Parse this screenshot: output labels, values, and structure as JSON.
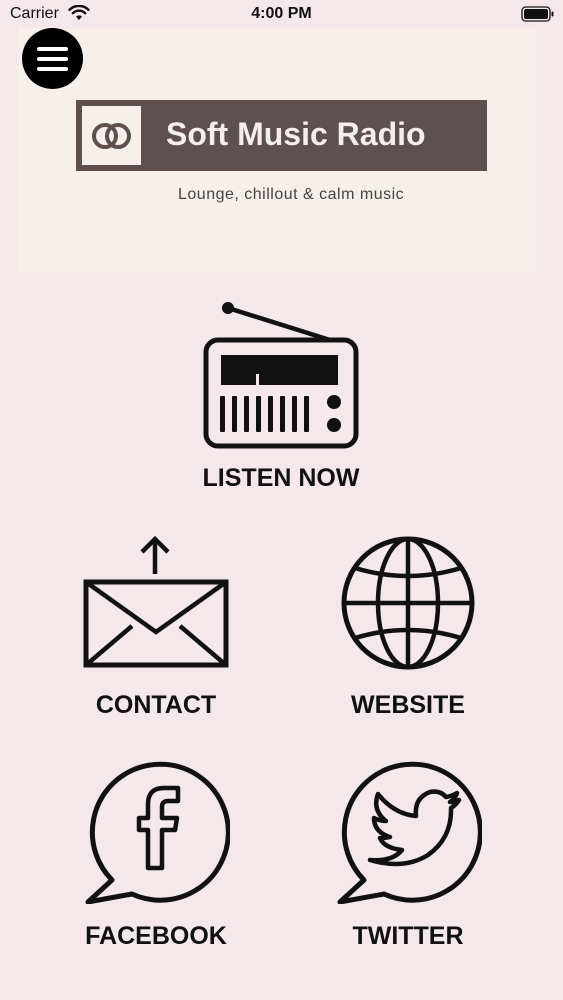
{
  "status_bar": {
    "carrier": "Carrier",
    "time": "4:00 PM",
    "icons": [
      "wifi-icon",
      "battery-icon"
    ]
  },
  "header": {
    "title": "Soft Music Radio",
    "tagline": "Lounge, chillout & calm music",
    "brand_color": "#5e4f50"
  },
  "nav": {
    "listen": {
      "label": "LISTEN NOW",
      "icon": "radio-icon"
    },
    "contact": {
      "label": "CONTACT",
      "icon": "envelope-icon"
    },
    "website": {
      "label": "WEBSITE",
      "icon": "globe-icon"
    },
    "facebook": {
      "label": "FACEBOOK",
      "icon": "facebook-icon"
    },
    "twitter": {
      "label": "TWITTER",
      "icon": "twitter-icon"
    }
  },
  "colors": {
    "background": "#f4e8ea",
    "menu_button": "#000000"
  }
}
